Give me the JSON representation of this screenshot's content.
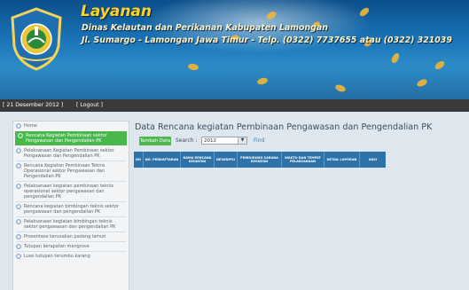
{
  "header": {
    "title": "Layanan",
    "subtitle_line1": "Dinas Kelautan dan Perikanan Kabupaten Lamongan",
    "subtitle_line2": "Jl. Sumargo - Lamongan Jawa Timur - Telp. (0322) 7737655 atau (0322) 321039"
  },
  "topbar": {
    "date": "[ 21 Desember 2012 ]",
    "logout": "[ Logout ]"
  },
  "sidebar": {
    "items": [
      {
        "label": "Home",
        "active": false
      },
      {
        "label": "Rencana Kegiatan Pembinaan sektor Pengawasan dan Pengendalian PK",
        "active": true
      },
      {
        "label": "Pelaksanaan Kegiatan Pembinaan sektor Pengawasan dan Pengendalian PK",
        "active": false
      },
      {
        "label": "Rencana Kegiatan Pembinaan Teknis Operasional sektor Pengawasan dan Pengendalian PK",
        "active": false
      },
      {
        "label": "Pelaksanaan kegiatan pembinaan teknis operasional sektor pengawasan dan pengendalian PK",
        "active": false
      },
      {
        "label": "Rencana kegiatan bimbingan teknis sektor pengawasan dan pengendalian PK",
        "active": false
      },
      {
        "label": "Pelaksanaan kegiatan bimbingan teknis sektor pengawasan dan pengendalian PK",
        "active": false
      },
      {
        "label": "Prosentase kerusakan padang lamun",
        "active": false
      },
      {
        "label": "Tutupan kerapatan mangrove",
        "active": false
      },
      {
        "label": "Luas tutupan terumbu karang",
        "active": false
      }
    ]
  },
  "main": {
    "title": "Data Rencana kegiatan Pembinaan Pengawasan dan Pengendalian PK",
    "add_button": "Tambah Data",
    "search_label": "Search :",
    "year_value": "2012",
    "find_link": "Find",
    "columns": [
      "NO",
      "NO. PENDAFTARAN",
      "NAMA RENCANA KEGIATAN",
      "DESKRIPSI",
      "PENDUDUNG SARANA KEGIATAN",
      "WAKTU DAN TEMPAT PELAKSANAAN",
      "DETAIL LAPORAN",
      "AKSI"
    ]
  },
  "colors": {
    "accent_green": "#48b84a",
    "table_header": "#2d72a8",
    "title_yellow": "#ffd428",
    "link_blue": "#1e88d8"
  },
  "icons": {
    "logo": "regency-emblem-icon",
    "bullet": "circle-bullet-icon",
    "dropdown": "chevron-down-icon"
  }
}
